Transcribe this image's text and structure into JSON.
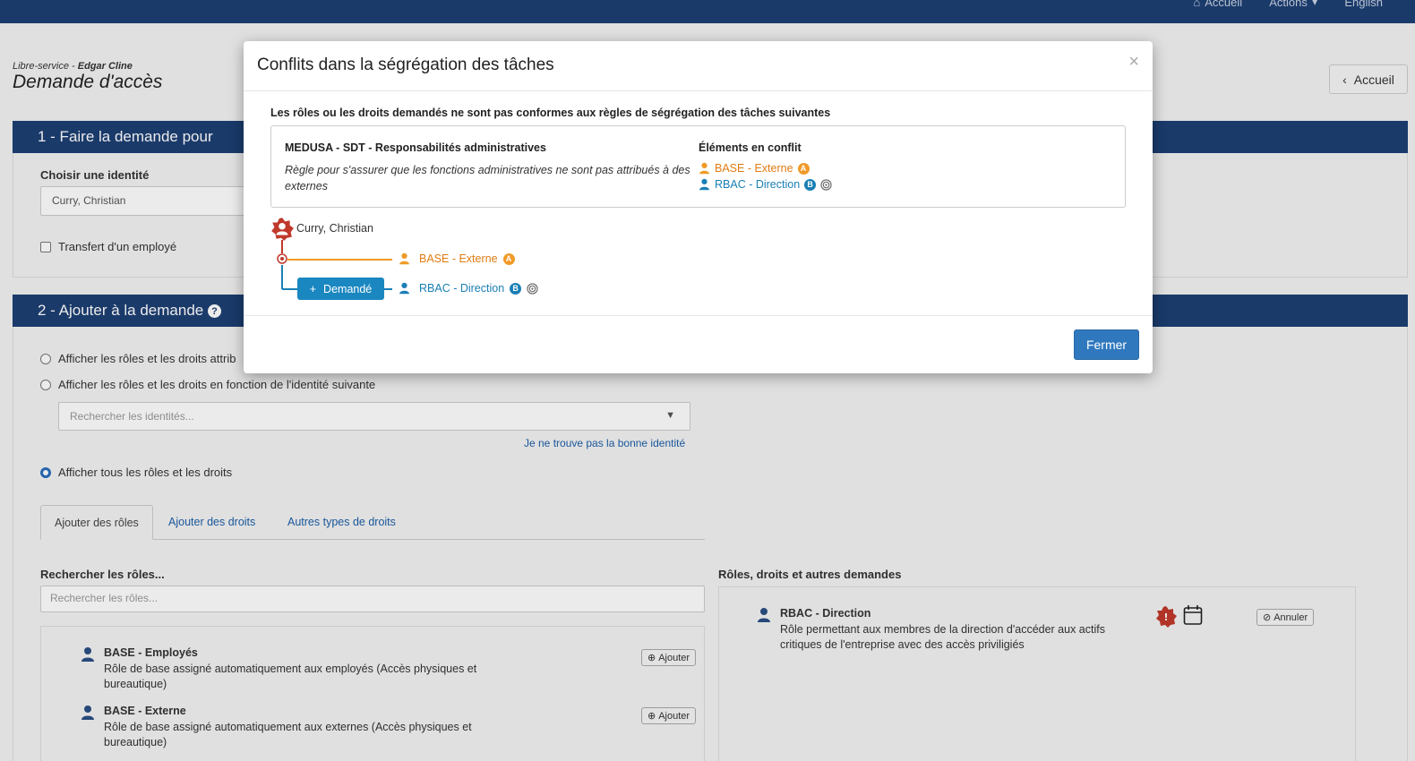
{
  "nav": {
    "home": "Accueil",
    "actions": "Actions",
    "language": "English"
  },
  "header": {
    "crumb_prefix": "Libre-service - ",
    "crumb_user": "Edgar Cline",
    "title": "Demande d'accès",
    "back_label": "Accueil"
  },
  "section1": {
    "title": "1 - Faire la demande pour",
    "identity_label": "Choisir une identité",
    "identity_value": "Curry, Christian",
    "transfer_label": "Transfert d'un employé"
  },
  "section2": {
    "title": "2 - Ajouter à la demande",
    "option1": "Afficher les rôles et les droits attrib",
    "option2": "Afficher les rôles et les droits en fonction de l'identité suivante",
    "search_identities_placeholder": "Rechercher les identités...",
    "not_found_link": "Je ne trouve pas la bonne identité",
    "option3": "Afficher tous les rôles et les droits",
    "tabs": [
      "Ajouter des rôles",
      "Ajouter des droits",
      "Autres types de droits"
    ],
    "search_roles_label": "Rechercher les rôles...",
    "search_roles_placeholder": "Rechercher les rôles...",
    "roles": [
      {
        "name": "BASE - Employés",
        "desc": "Rôle de base assigné automatiquement aux employés (Accès physiques et bureautique)",
        "button": "Ajouter"
      },
      {
        "name": "BASE - Externe",
        "desc": "Rôle de base assigné automatiquement aux externes (Accès physiques et bureautique)",
        "button": "Ajouter"
      }
    ],
    "requests_label": "Rôles, droits et autres demandes",
    "request_item": {
      "name": "RBAC - Direction",
      "desc": "Rôle permettant aux membres de la direction d'accéder aux actifs critiques de l'entreprise avec des accès priviligiés",
      "cancel": "Annuler"
    }
  },
  "modal": {
    "title": "Conflits dans la ségrégation des tâches",
    "close_x": "×",
    "intro": "Les rôles ou les droits demandés ne sont pas conformes aux règles de ségrégation des tâches suivantes",
    "rule_name": "MEDUSA - SDT - Responsabilités administratives",
    "rule_desc": "Règle pour s'assurer que les fonctions administratives ne sont pas attribués à des externes",
    "conflicts_head": "Éléments en conflit",
    "conflict_a": "BASE - Externe",
    "conflict_b": "RBAC - Direction",
    "badge_a": "A",
    "badge_b": "B",
    "tree_user": "Curry, Christian",
    "tree_a": "BASE - Externe",
    "tree_b": "RBAC - Direction",
    "requested_label": "Demandé",
    "close_button": "Fermer"
  }
}
